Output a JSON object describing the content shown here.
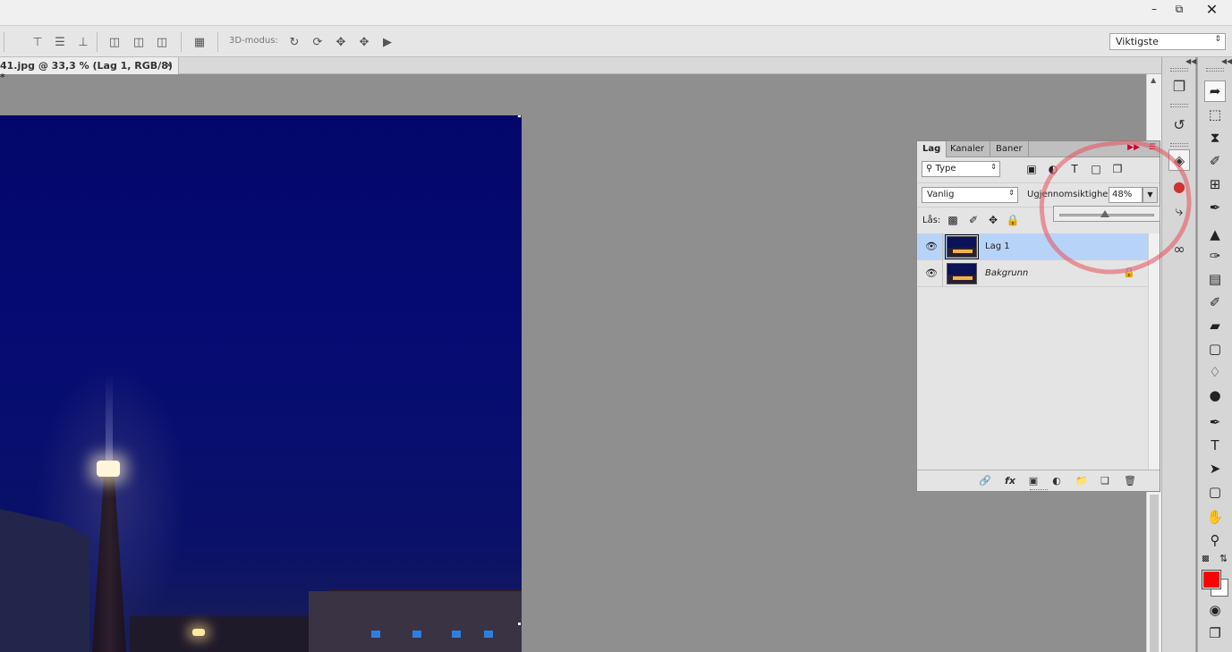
{
  "window": {
    "minimize": "–",
    "restore": "⧉",
    "close": "✕"
  },
  "options_bar": {
    "mode_3d_label": "3D-modus:",
    "workspace_select": "Viktigste",
    "icons": [
      "align-top-icon",
      "align-vcenter-icon",
      "align-bottom-icon",
      "align-left-icon",
      "align-hcenter-icon",
      "align-right-icon",
      "distribute-icon",
      "orbit-icon",
      "roll-icon",
      "pan-icon",
      "slide-icon",
      "scale-icon"
    ]
  },
  "document_tab": {
    "title": "41.jpg @ 33,3 % (Lag 1, RGB/8) *",
    "close": "×"
  },
  "layers_panel": {
    "tabs": [
      "Lag",
      "Kanaler",
      "Baner"
    ],
    "filter_select": "Type",
    "blend_mode": "Vanlig",
    "opacity_label": "Ugjennomsiktighet:",
    "opacity_value": "48%",
    "opacity_percent": 48,
    "lock_label": "Lås:",
    "layers": [
      {
        "name": "Lag 1",
        "selected": true,
        "locked": false
      },
      {
        "name": "Bakgrunn",
        "selected": false,
        "locked": true
      }
    ]
  },
  "colors": {
    "foreground": "#ff0000",
    "background": "#ffffff",
    "layer_selected": "#b8d3f8",
    "annotation": "#e6505a"
  }
}
